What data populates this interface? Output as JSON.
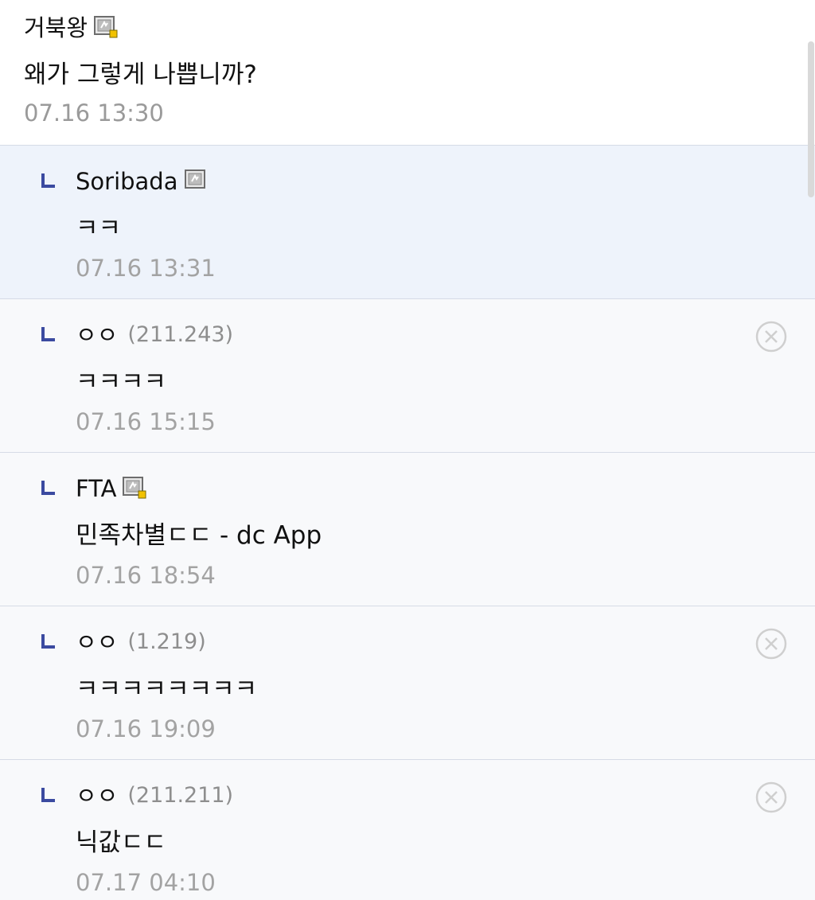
{
  "top_comment": {
    "author": "거북왕",
    "text": "왜가 그렇게 나쁩니까?",
    "time": "07.16 13:30",
    "has_gallery_icon": true,
    "gallery_icon_badge": true
  },
  "replies": [
    {
      "author": "Soribada",
      "ip": "",
      "text": "ㅋㅋ",
      "time": "07.16 13:31",
      "has_gallery_icon": true,
      "gallery_icon_badge": false,
      "highlighted": true,
      "deletable": false
    },
    {
      "author": "ㅇㅇ",
      "ip": "(211.243)",
      "text": "ㅋㅋㅋㅋ",
      "time": "07.16 15:15",
      "has_gallery_icon": false,
      "highlighted": false,
      "deletable": true
    },
    {
      "author": "FTA",
      "ip": "",
      "text": "민족차별ㄷㄷ - dc App",
      "time": "07.16 18:54",
      "has_gallery_icon": true,
      "gallery_icon_badge": true,
      "highlighted": false,
      "deletable": false
    },
    {
      "author": "ㅇㅇ",
      "ip": "(1.219)",
      "text": "ㅋㅋㅋㅋㅋㅋㅋㅋ",
      "time": "07.16 19:09",
      "has_gallery_icon": false,
      "highlighted": false,
      "deletable": true
    },
    {
      "author": "ㅇㅇ",
      "ip": "(211.211)",
      "text": "닉값ㄷㄷ",
      "time": "07.17 04:10",
      "has_gallery_icon": false,
      "highlighted": false,
      "deletable": true
    }
  ],
  "icons": {
    "reply_marker": "reply-corner-icon",
    "gallery": "gallery-member-icon",
    "delete": "delete-circle-x-icon"
  },
  "colors": {
    "highlight_bg": "#eef3fb",
    "reply_bg": "#f8f9fb",
    "divider": "#d6dbe6",
    "reply_marker": "#3b4aa0",
    "time_text": "#a3a3a3",
    "ip_text": "#8e8e8e",
    "badge_yellow": "#f2c200"
  }
}
